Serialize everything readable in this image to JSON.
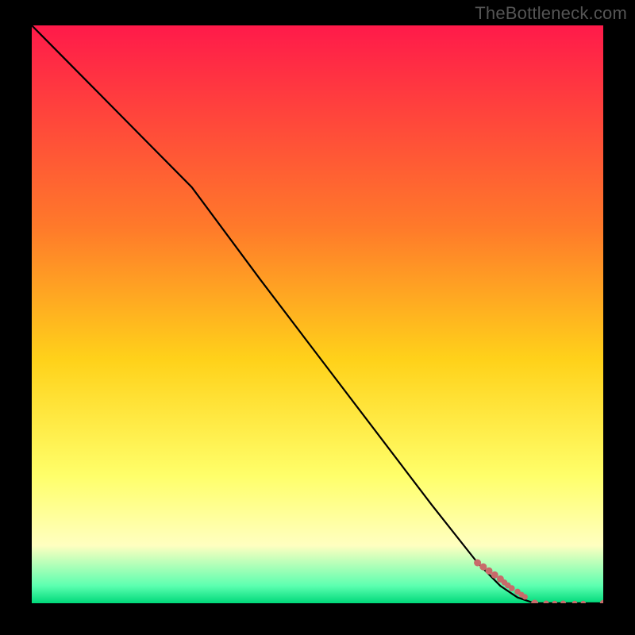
{
  "watermark": "TheBottleneck.com",
  "colors": {
    "bg_black": "#000000",
    "grad_top": "#ff1a4a",
    "grad_mid1": "#ff7a2a",
    "grad_mid2": "#ffd21a",
    "grad_mid3": "#ffff6a",
    "grad_bot1": "#ffffc0",
    "grad_bot2": "#5cffb0",
    "grad_edge": "#00d97a",
    "line": "#000000",
    "marker": "#c86a6a"
  },
  "chart_data": {
    "type": "line",
    "title": "",
    "xlabel": "",
    "ylabel": "",
    "xlim": [
      0,
      100
    ],
    "ylim": [
      0,
      100
    ],
    "series": [
      {
        "name": "curve",
        "x": [
          0,
          10,
          20,
          28,
          40,
          50,
          60,
          70,
          78,
          82,
          85,
          88,
          100
        ],
        "y": [
          100,
          90,
          80,
          72,
          56,
          43,
          30,
          17,
          7,
          3,
          1,
          0,
          0
        ]
      }
    ],
    "markers": {
      "name": "points",
      "x": [
        78,
        79,
        80,
        81,
        82,
        82.7,
        83.3,
        84,
        85,
        85.7,
        86.3,
        88,
        90,
        91.5,
        93,
        95,
        96.5,
        100
      ],
      "y": [
        7,
        6.3,
        5.6,
        4.9,
        4.2,
        3.6,
        3.1,
        2.6,
        2,
        1.5,
        1.1,
        0,
        0,
        0,
        0,
        0,
        0,
        0
      ],
      "r": [
        4.5,
        4.5,
        4.5,
        4.5,
        4.5,
        3.8,
        3.8,
        3.8,
        3.8,
        3.5,
        3.5,
        4.5,
        3.5,
        3.2,
        3.5,
        3.2,
        3.2,
        4.2
      ]
    }
  }
}
